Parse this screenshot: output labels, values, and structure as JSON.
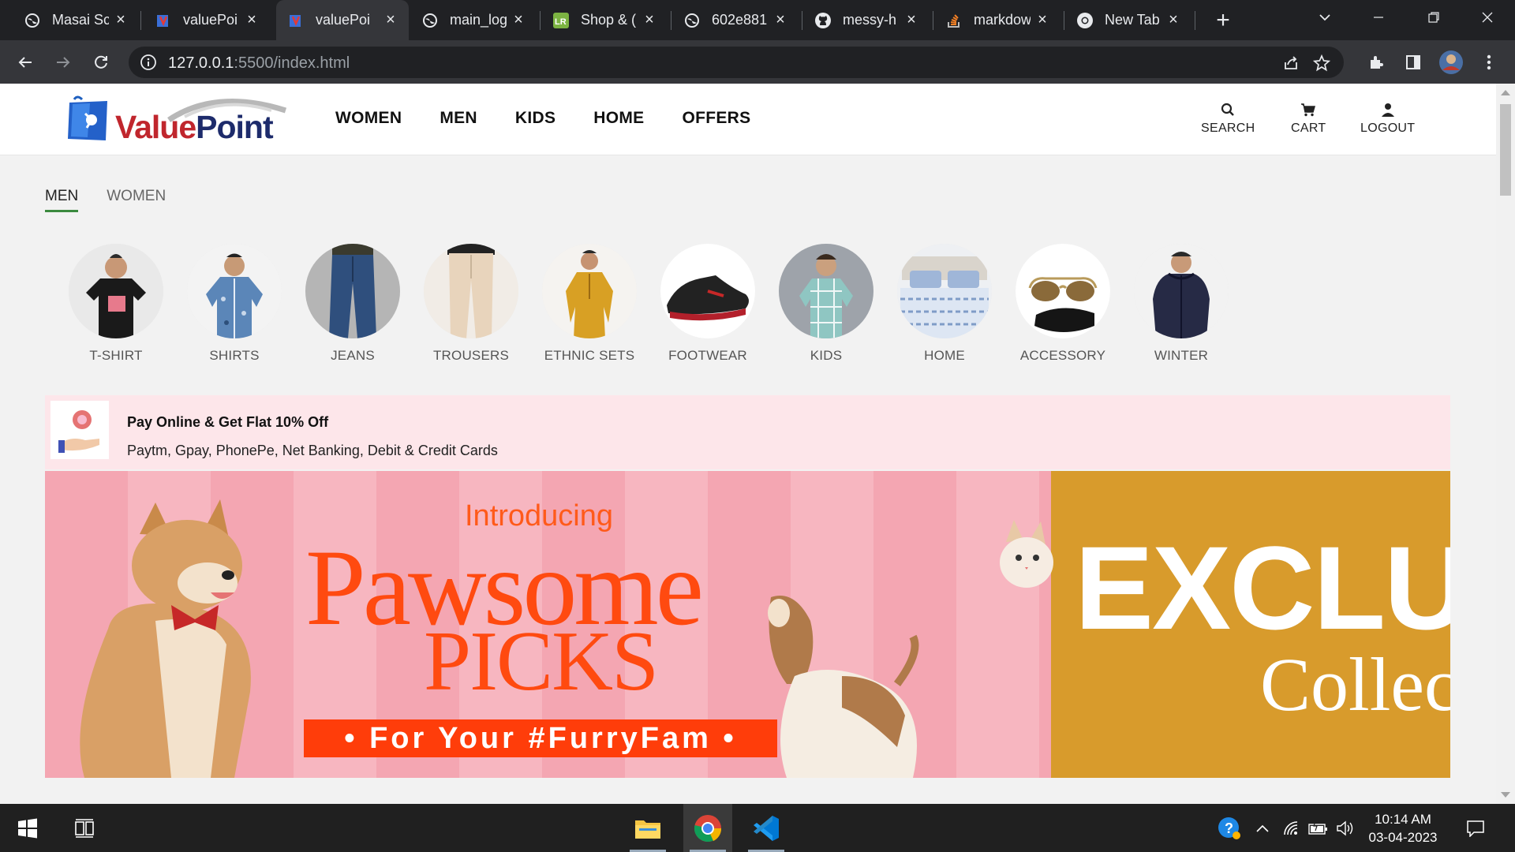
{
  "browser": {
    "tabs": [
      {
        "label": "Masai Sc",
        "icon": "globe-icon",
        "active": false
      },
      {
        "label": "valuePoi",
        "icon": "valuepoint-favicon",
        "active": false
      },
      {
        "label": "valuePoi",
        "icon": "valuepoint-favicon",
        "active": true
      },
      {
        "label": "main_log",
        "icon": "globe-icon",
        "active": false
      },
      {
        "label": "Shop & (",
        "icon": "lr-favicon",
        "active": false
      },
      {
        "label": "602e881",
        "icon": "globe-icon",
        "active": false
      },
      {
        "label": "messy-h",
        "icon": "github-icon",
        "active": false
      },
      {
        "label": "markdow",
        "icon": "stackoverflow-icon",
        "active": false
      },
      {
        "label": "New Tab",
        "icon": "chrome-icon",
        "active": false
      }
    ],
    "url_host": "127.0.0.1",
    "url_path": ":5500/index.html"
  },
  "site": {
    "brand": {
      "value": "Value",
      "point": "Point"
    },
    "nav": [
      "WOMEN",
      "MEN",
      "KIDS",
      "HOME",
      "OFFERS"
    ],
    "actions": {
      "search": "SEARCH",
      "cart": "CART",
      "logout": "LOGOUT"
    },
    "gender_tabs": [
      {
        "label": "MEN",
        "active": true
      },
      {
        "label": "WOMEN",
        "active": false
      }
    ],
    "categories": [
      {
        "label": "T-SHIRT",
        "icon": "tshirt-icon",
        "color": "#1a1a1a"
      },
      {
        "label": "SHIRTS",
        "icon": "shirt-icon",
        "color": "#5b86b8"
      },
      {
        "label": "JEANS",
        "icon": "jeans-icon",
        "color": "#2f4f7d"
      },
      {
        "label": "TROUSERS",
        "icon": "trousers-icon",
        "color": "#e8d4bc"
      },
      {
        "label": "ETHNIC SETS",
        "icon": "kurta-icon",
        "color": "#d8a024"
      },
      {
        "label": "FOOTWEAR",
        "icon": "shoe-icon",
        "color": "#222222"
      },
      {
        "label": "KIDS",
        "icon": "kid-shirt-icon",
        "color": "#8fc6c2"
      },
      {
        "label": "HOME",
        "icon": "bed-icon",
        "color": "#9fb6d8"
      },
      {
        "label": "ACCESSORY",
        "icon": "sunglasses-icon",
        "color": "#8a6a3a"
      },
      {
        "label": "WINTER",
        "icon": "jacket-icon",
        "color": "#262a45"
      }
    ],
    "offer": {
      "title": "Pay Online & Get Flat 10% Off",
      "subtitle": "Paytm, Gpay, PhonePe, Net Banking, Debit & Credit Cards"
    },
    "banner": {
      "intro": "Introducing",
      "headline": "Pawsome",
      "headline2": "PICKS",
      "tagline": "• For Your #FurryFam •",
      "right_headline": "EXCLUS",
      "right_sub": "Collec",
      "colors": {
        "pink": "#f4a6b2",
        "orange": "#ff4a10",
        "gold": "#d89b2c"
      }
    }
  },
  "taskbar": {
    "time": "10:14 AM",
    "date": "03-04-2023"
  }
}
